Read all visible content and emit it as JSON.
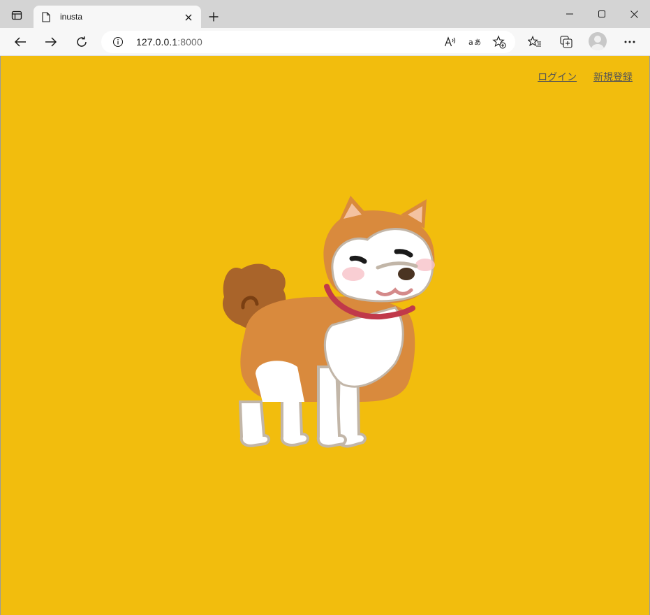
{
  "tab": {
    "title": "inusta",
    "close_icon": "close-icon",
    "page_icon": "page-icon"
  },
  "new_tab_icon": "plus-icon",
  "window_controls": {
    "minimize": "minimize-icon",
    "maximize": "maximize-icon",
    "close": "close-icon"
  },
  "address": {
    "host": "127.0.0.1",
    "port": ":8000"
  },
  "nav": {
    "login": "ログイン",
    "register": "新規登録"
  },
  "colors": {
    "page_bg": "#f2bd0d",
    "link": "#555555",
    "dog_fur": "#d98a3d",
    "collar": "#c0394a"
  },
  "hero_image": "akita-dog-illustration"
}
